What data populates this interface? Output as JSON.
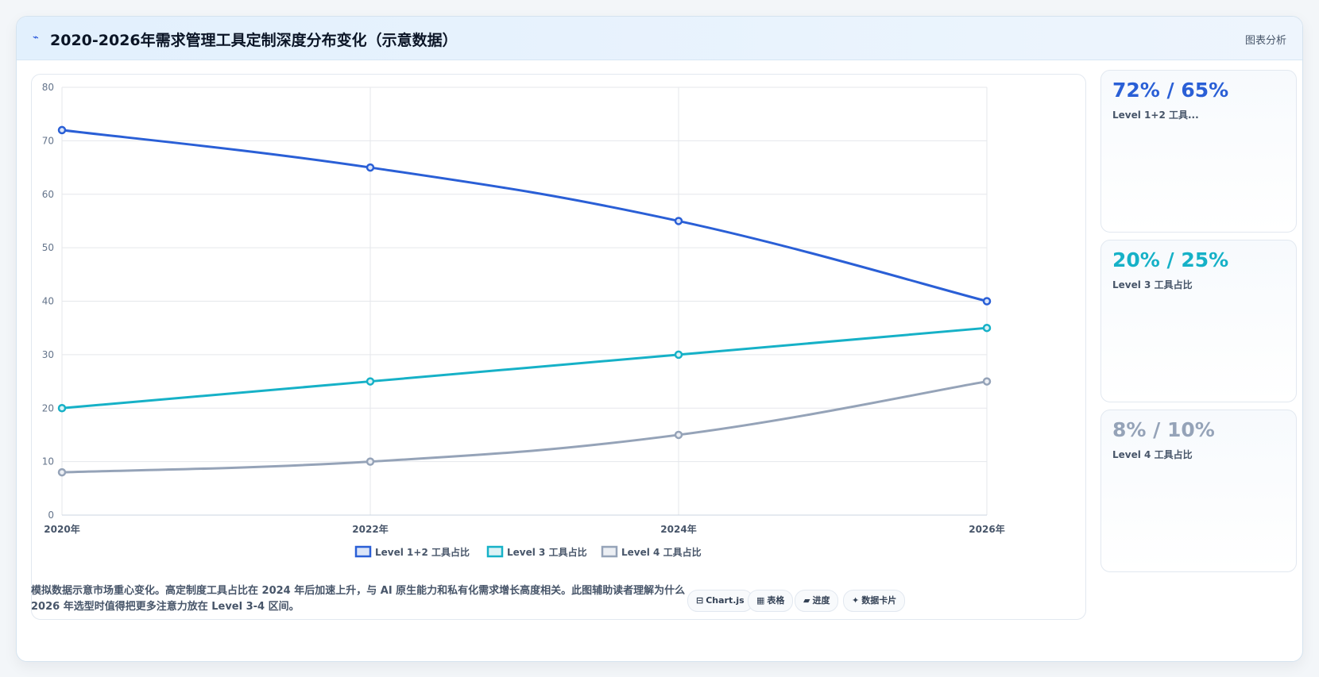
{
  "header": {
    "icon": "chart-line-icon",
    "title": "2020-2026年需求管理工具定制深度分布变化（示意数据）",
    "tag": "图表分析"
  },
  "chart_data": {
    "type": "line",
    "x": [
      "2020年",
      "2022年",
      "2024年",
      "2026年"
    ],
    "ylim": [
      0,
      80
    ],
    "yticks": [
      0,
      10,
      20,
      30,
      40,
      50,
      60,
      70,
      80
    ],
    "grid": true,
    "legend_position": "bottom",
    "series": [
      {
        "name": "Level 1+2 工具占比",
        "values": [
          72,
          65,
          55,
          40
        ],
        "color": "#2a5fd6",
        "fill": "#dbe5f8"
      },
      {
        "name": "Level 3 工具占比",
        "values": [
          20,
          25,
          30,
          35
        ],
        "color": "#16b1c7",
        "fill": "#dcf2f5"
      },
      {
        "name": "Level 4 工具占比",
        "values": [
          8,
          10,
          15,
          25
        ],
        "color": "#95a3b8",
        "fill": "#eceff4"
      }
    ]
  },
  "stats": [
    {
      "value": "72% / 65%",
      "label": "Level 1+2 工具...",
      "color": "#2a5fd6"
    },
    {
      "value": "20% / 25%",
      "label": "Level 3 工具占比",
      "color": "#16b1c7"
    },
    {
      "value": "8% / 10%",
      "label": "Level 4 工具占比",
      "color": "#95a3b8"
    }
  ],
  "footer": {
    "note": "模拟数据示意市场重心变化。高定制度工具占比在 2024 年后加速上升，与 AI 原生能力和私有化需求增长高度相关。此图辅助读者理解为什么 2026 年选型时值得把更多注意力放在 Level 3-4 区间。",
    "pills": [
      {
        "icon": "⊟",
        "label": "Chart.js"
      },
      {
        "icon": "▦",
        "label": "表格"
      },
      {
        "icon": "▰",
        "label": "进度"
      },
      {
        "icon": "✦",
        "label": "数据卡片"
      }
    ]
  }
}
